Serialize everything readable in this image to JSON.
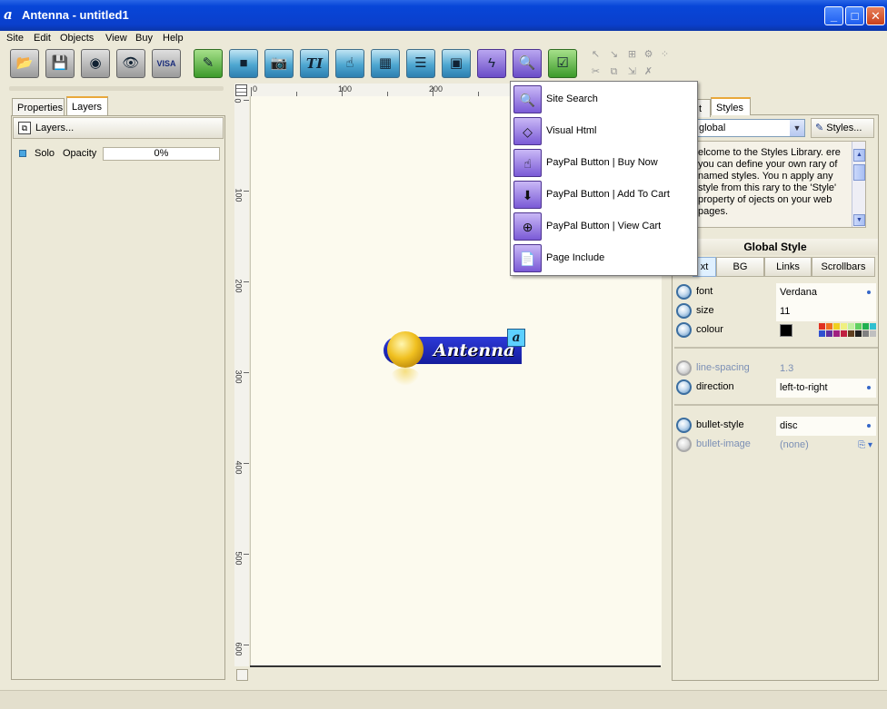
{
  "window": {
    "title": "Antenna - untitled1"
  },
  "menu": [
    "Site",
    "Edit",
    "Objects",
    "View",
    "Buy",
    "Help"
  ],
  "left_panel": {
    "tabs": [
      "Properties",
      "Layers"
    ],
    "layers_button": "Layers...",
    "solo_label": "Solo",
    "opacity_label": "Opacity",
    "opacity_value": "0%"
  },
  "rulers": {
    "top": [
      "0",
      "100",
      "200"
    ],
    "left": [
      "0",
      "100",
      "200",
      "300",
      "400",
      "500",
      "600"
    ]
  },
  "logo": {
    "text": "Antenna"
  },
  "dropdown": {
    "items": [
      {
        "label": "Site Search",
        "icon": "magnifier-icon"
      },
      {
        "label": "Visual Html",
        "icon": "code-brackets-icon"
      },
      {
        "label": "PayPal Button | Buy Now",
        "icon": "paypal-buynow-icon"
      },
      {
        "label": "PayPal Button | Add To Cart",
        "icon": "paypal-cart-icon"
      },
      {
        "label": "PayPal Button | View Cart",
        "icon": "paypal-eye-icon"
      },
      {
        "label": "Page Include",
        "icon": "page-include-icon"
      }
    ]
  },
  "right_panel": {
    "tabs": [
      "t",
      "Styles"
    ],
    "style_select": "global",
    "styles_button": "Styles...",
    "info_text": "elcome to the Styles Library. ere you can define your own rary of named styles. You n apply any style from this rary to the 'Style' property of ojects on your web pages.",
    "heading": "Global Style",
    "subtabs": [
      "xt",
      "BG",
      "Links",
      "Scrollbars"
    ],
    "properties": [
      {
        "name": "font",
        "value": "Verdana"
      },
      {
        "name": "size",
        "value": "11"
      },
      {
        "name": "colour",
        "value": ""
      },
      {
        "name": "line-spacing",
        "value": "1.3"
      },
      {
        "name": "direction",
        "value": "left-to-right"
      },
      {
        "name": "bullet-style",
        "value": "disc"
      },
      {
        "name": "bullet-image",
        "value": "(none)"
      }
    ],
    "colour_swatch": "#000000",
    "palette": [
      "#e03020",
      "#f07020",
      "#f0d020",
      "#f0f080",
      "#c0f0a0",
      "#60d060",
      "#20b050",
      "#30c0d0",
      "#3050d0",
      "#6030a0",
      "#a02080",
      "#c02040",
      "#604020",
      "#202020",
      "#808080",
      "#c0c0c0"
    ]
  },
  "colors": {
    "title": "#0a3fcc",
    "page": "#fcfaee",
    "accent": "#e9a83a"
  }
}
